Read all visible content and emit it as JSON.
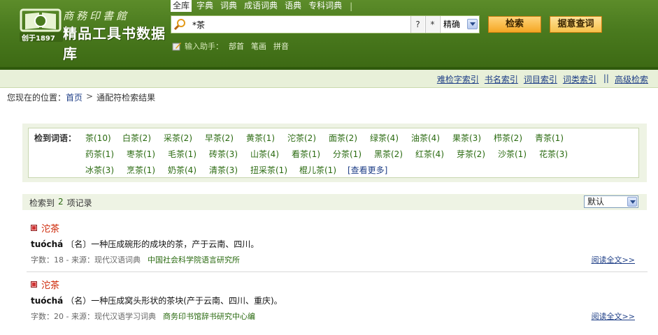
{
  "brand": {
    "script_text": "商務印書館",
    "title": "精品工具书数据库",
    "since": "创于1897"
  },
  "nav": {
    "tabs": [
      "全库",
      "字典",
      "词典",
      "成语词典",
      "语典",
      "专科词典"
    ],
    "active_index": 0,
    "separator": "|"
  },
  "search": {
    "query": "*茶",
    "q_mark": "?",
    "star": "*",
    "mode": "精确",
    "search_btn": "检索",
    "advanced_btn": "据意查词"
  },
  "helper": {
    "label": "输入助手：",
    "links": [
      "部首",
      "笔画",
      "拼音"
    ]
  },
  "index_links": {
    "items": [
      "难检字索引",
      "书名索引",
      "词目索引",
      "词类索引"
    ],
    "separator": "||",
    "advanced": "高级检索"
  },
  "breadcrumb": {
    "prefix": "您现在的位置：",
    "home": "首页",
    "arrow": ">",
    "current": "通配符检索结果"
  },
  "words": {
    "label": "检到词语：",
    "rows": [
      [
        "茶(10)",
        "白茶(2)",
        "采茶(2)",
        "早茶(2)",
        "黄茶(1)",
        "沱茶(2)",
        "面茶(2)",
        "绿茶(4)",
        "油茶(4)",
        "果茶(3)",
        "栉茶(2)",
        "青茶(1)"
      ],
      [
        "药茶(1)",
        "枣茶(1)",
        "毛茶(1)",
        "砖茶(3)",
        "山茶(4)",
        "看茶(1)",
        "分茶(1)",
        "黑茶(2)",
        "红茶(4)",
        "芽茶(2)",
        "沙茶(1)",
        "花茶(3)"
      ],
      [
        "冰茶(3)",
        "烹茶(1)",
        "奶茶(4)",
        "清茶(3)",
        "扭采茶(1)",
        "棍儿茶(1)"
      ]
    ],
    "more": "[查看更多]"
  },
  "results_header": {
    "prefix": "检索到",
    "count": "2",
    "suffix": "项记录",
    "sort": "默认"
  },
  "results": [
    {
      "title": "沱茶",
      "pinyin": "tuóchá",
      "definition": "〔名〕一种压成碗形的成块的茶，产于云南、四川。",
      "meta": "字数：18 - 来源：现代汉语词典",
      "publisher": "中国社会科学院语言研究所",
      "read_more": "阅读全文>>"
    },
    {
      "title": "沱茶",
      "pinyin": "tuóchá",
      "definition": "（名）一种压成窝头形状的茶块(产于云南、四川、重庆)。",
      "meta": "字数：20 - 来源：现代汉语学习词典",
      "publisher": "商务印书馆辞书研究中心编",
      "read_more": "阅读全文>>"
    }
  ]
}
